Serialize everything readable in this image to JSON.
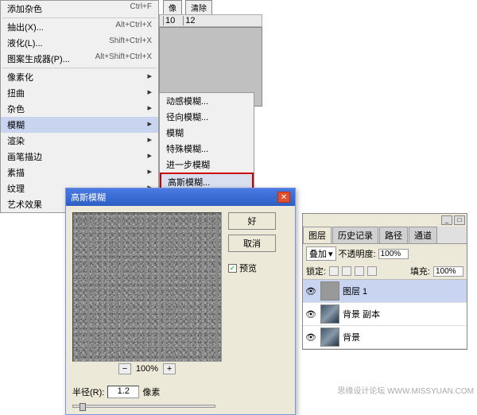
{
  "topButtons": {
    "b1": "像",
    "b2": "清除"
  },
  "menu": [
    {
      "label": "添加杂色",
      "shortcut": "Ctrl+F"
    },
    {
      "label": "抽出(X)...",
      "shortcut": "Alt+Ctrl+X"
    },
    {
      "label": "液化(L)...",
      "shortcut": "Shift+Ctrl+X"
    },
    {
      "label": "图案生成器(P)...",
      "shortcut": "Alt+Shift+Ctrl+X"
    },
    {
      "label": "像素化",
      "arrow": true
    },
    {
      "label": "扭曲",
      "arrow": true
    },
    {
      "label": "杂色",
      "arrow": true
    },
    {
      "label": "模糊",
      "arrow": true,
      "highlight": true
    },
    {
      "label": "渲染",
      "arrow": true
    },
    {
      "label": "画笔描边",
      "arrow": true
    },
    {
      "label": "素描",
      "arrow": true
    },
    {
      "label": "纹理",
      "arrow": true
    },
    {
      "label": "艺术效果",
      "arrow": true
    }
  ],
  "submenu": [
    {
      "label": "动感模糊..."
    },
    {
      "label": "径向模糊..."
    },
    {
      "label": "模糊"
    },
    {
      "label": "特殊模糊..."
    },
    {
      "label": "进一步模糊"
    },
    {
      "label": "高斯模糊...",
      "sel": true
    }
  ],
  "ruler": {
    "marks": [
      "10",
      "12"
    ]
  },
  "dialog": {
    "title": "高斯模糊",
    "ok": "好",
    "cancel": "取消",
    "preview": "预览",
    "zoom": "100%",
    "radiusLabel": "半径(R):",
    "radiusValue": "1.2",
    "radiusUnit": "像素"
  },
  "layers": {
    "tabs": [
      "图层",
      "历史记录",
      "路径",
      "通道"
    ],
    "blendMode": "叠加",
    "opacityLabel": "不透明度:",
    "opacityValue": "100%",
    "lockLabel": "锁定:",
    "fillLabel": "填充:",
    "fillValue": "100%",
    "rows": [
      {
        "name": "图层 1",
        "sel": true,
        "thumb": "noise"
      },
      {
        "name": "背景 副本",
        "thumb": "photo"
      },
      {
        "name": "背景",
        "thumb": "photo"
      }
    ]
  },
  "watermark": "思缘设计论坛  WWW.MISSYUAN.COM"
}
